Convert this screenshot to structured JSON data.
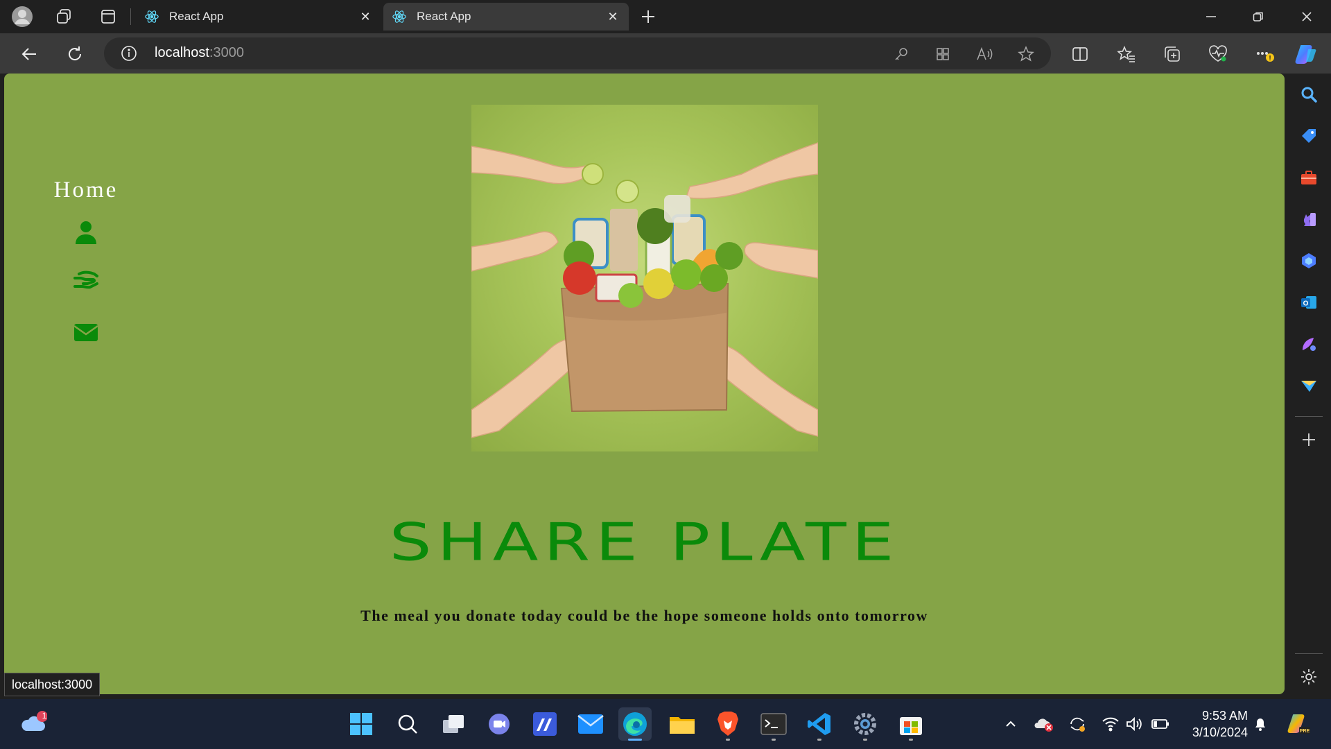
{
  "browser": {
    "tabs": [
      {
        "label": "React App",
        "active": false
      },
      {
        "label": "React App",
        "active": true
      }
    ],
    "url_host": "localhost",
    "url_port": ":3000",
    "status_url": "localhost:3000"
  },
  "page": {
    "nav": {
      "home_label": "Home",
      "items": [
        "user-icon",
        "donate-hand-icon",
        "mail-icon"
      ]
    },
    "hero_image_subject": "hands-reaching-grocery-bag",
    "brand_title": "SHARE PLATE",
    "tagline": "The meal you donate today could be the hope someone holds onto tomorrow",
    "colors": {
      "background": "#85a447",
      "brand": "#0a8a0a",
      "nav_icons": "#0a8a0a",
      "tagline": "#111111"
    }
  },
  "taskbar": {
    "weather_badge": "1",
    "time": "9:53 AM",
    "date": "3/10/2024"
  }
}
